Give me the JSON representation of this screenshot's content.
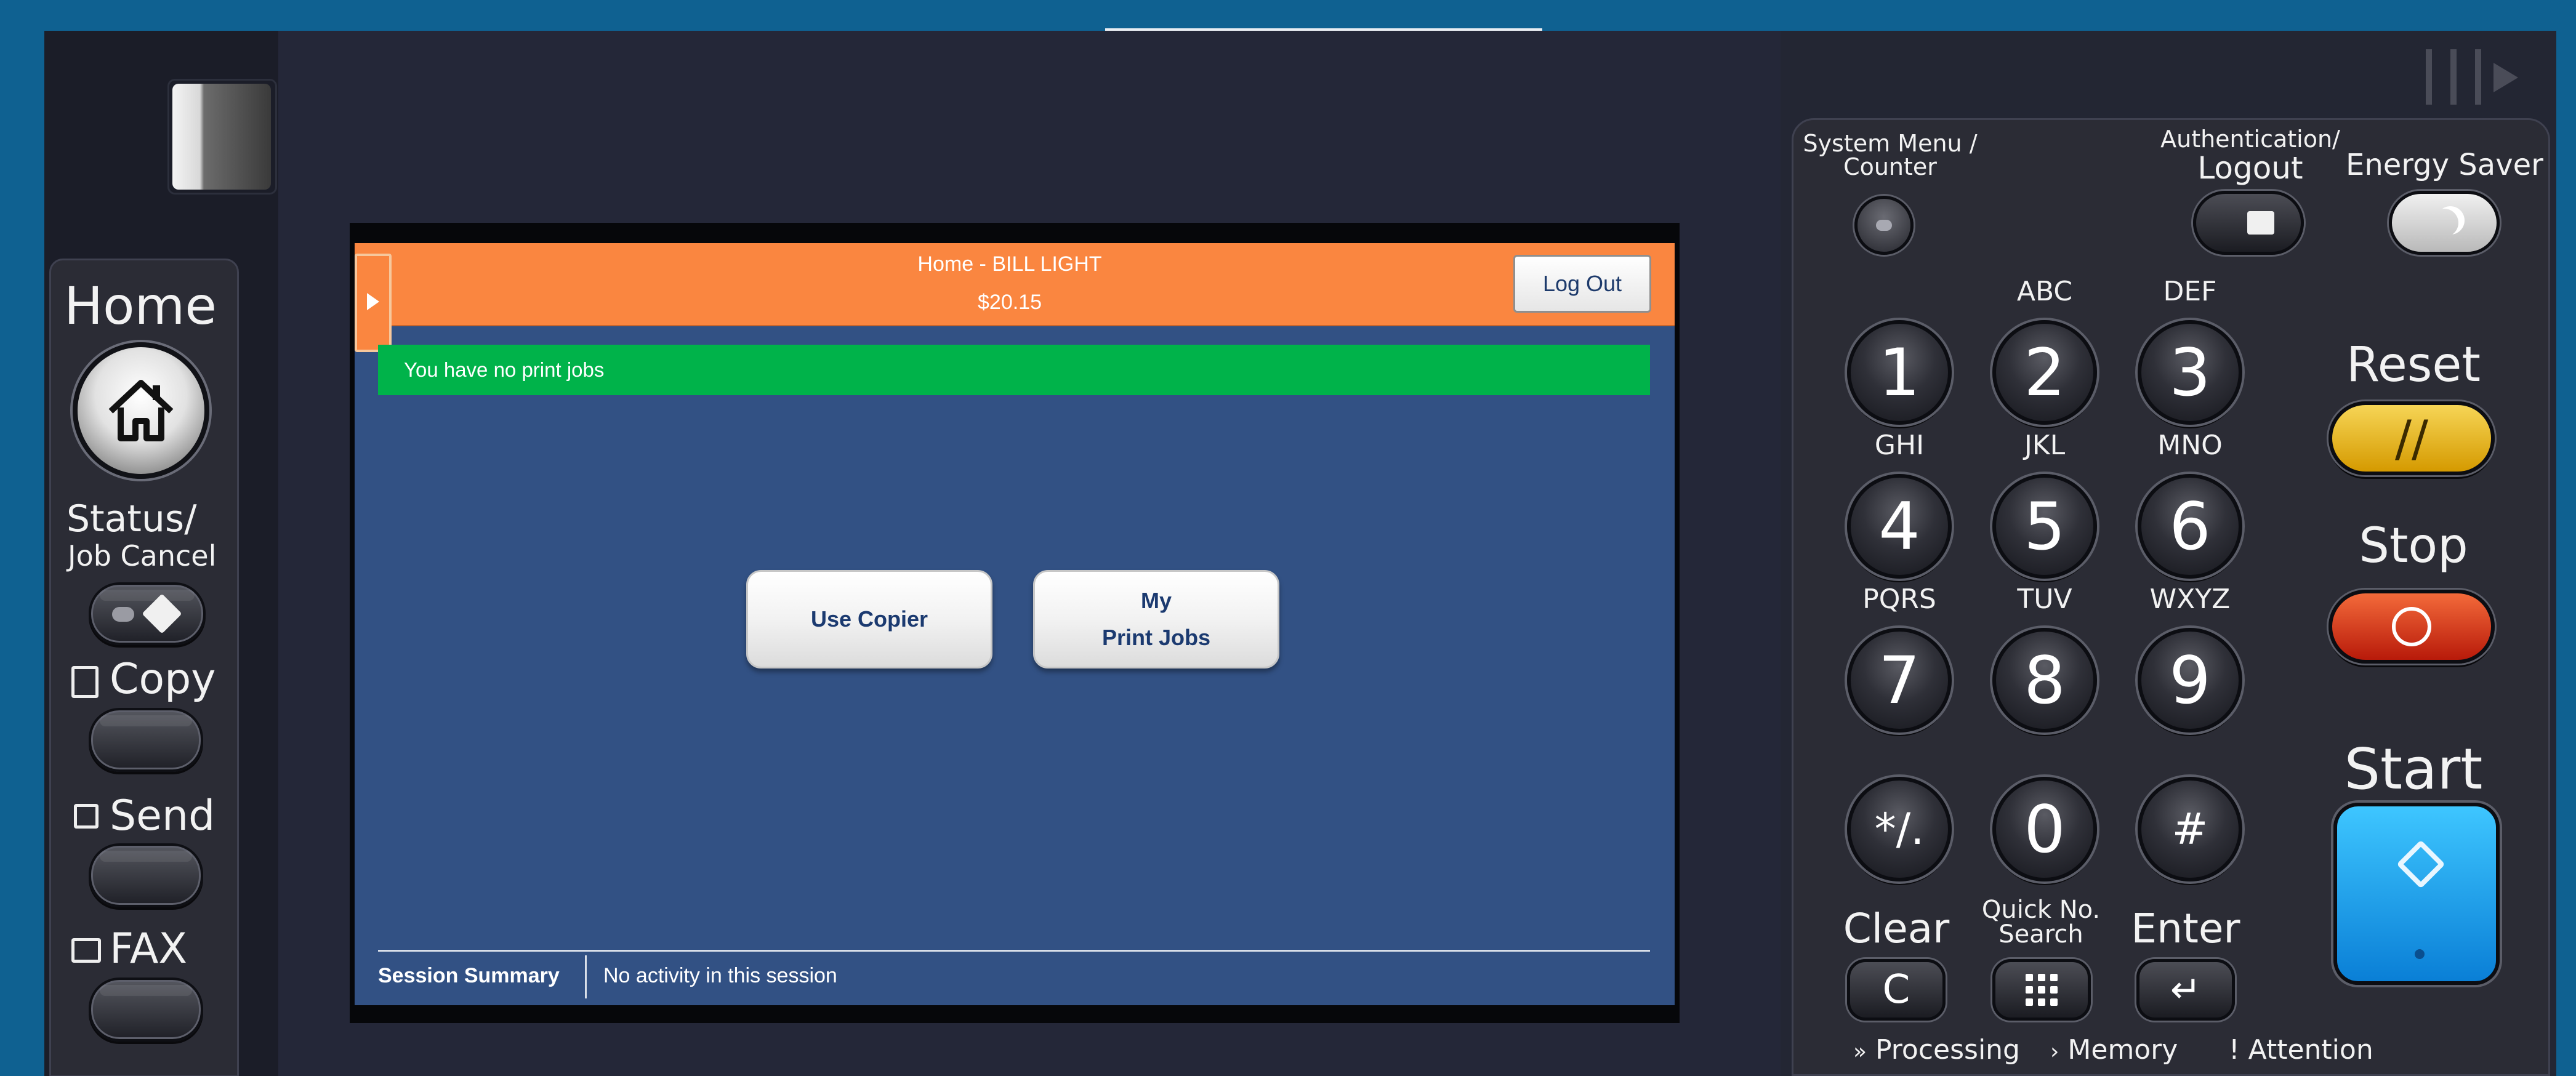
{
  "panel": {
    "left_keys": {
      "home": "Home",
      "status_line1": "Status/",
      "status_line2": "Job Cancel",
      "copy": "Copy",
      "send": "Send",
      "fax": "FAX"
    },
    "right_keys": {
      "system_menu_line1": "System Menu /",
      "system_menu_line2": "Counter",
      "auth_line1": "Authentication/",
      "auth_line2": "Logout",
      "energy_saver": "Energy Saver",
      "reset": "Reset",
      "stop": "Stop",
      "start": "Start",
      "clear": "Clear",
      "clear_key": "C",
      "quick_line1": "Quick No.",
      "quick_line2": "Search",
      "enter": "Enter",
      "keypad": [
        {
          "digit": "1",
          "letters": ""
        },
        {
          "digit": "2",
          "letters": "ABC"
        },
        {
          "digit": "3",
          "letters": "DEF"
        },
        {
          "digit": "4",
          "letters": "GHI"
        },
        {
          "digit": "5",
          "letters": "JKL"
        },
        {
          "digit": "6",
          "letters": "MNO"
        },
        {
          "digit": "7",
          "letters": "PQRS"
        },
        {
          "digit": "8",
          "letters": "TUV"
        },
        {
          "digit": "9",
          "letters": "WXYZ"
        },
        {
          "digit": "*/.",
          "letters": ""
        },
        {
          "digit": "0",
          "letters": ""
        },
        {
          "digit": "#",
          "letters": ""
        }
      ]
    },
    "indicators": {
      "processing": "Processing",
      "memory": "Memory",
      "attention": "Attention"
    },
    "colors": {
      "reset": "#e8b820",
      "stop": "#d9351a",
      "start": "#1ba4ee"
    }
  },
  "screen": {
    "header": {
      "title": "Home - BILL LIGHT",
      "balance": "$20.15",
      "logout_label": "Log Out"
    },
    "notice": "You have no print jobs",
    "buttons": {
      "use_copier": "Use Copier",
      "my_print_jobs_line1": "My",
      "my_print_jobs_line2": "Print Jobs"
    },
    "footer": {
      "session_label": "Session Summary",
      "session_status": "No activity in this session"
    },
    "colors": {
      "header": "#fa8640",
      "notice": "#00b34a",
      "background": "#325184"
    }
  }
}
